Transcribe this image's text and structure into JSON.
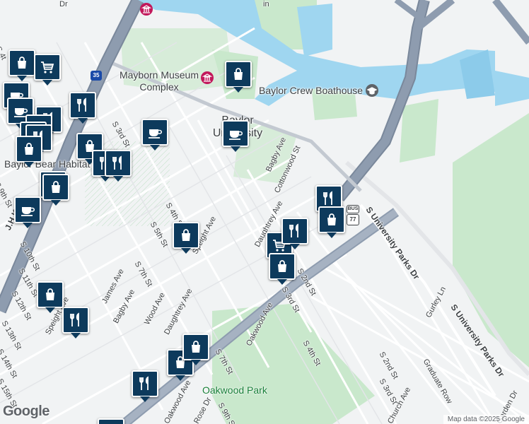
{
  "map": {
    "colors": {
      "background": "#f1f3f4",
      "water": "#9fd6f0",
      "park": "#c9e8cc",
      "highway": "#8e9caf",
      "highway_casing": "#7a889b",
      "road": "#ffffff",
      "minor_road": "#e3e5e8",
      "marker": "#0d3a5c"
    },
    "pois": {
      "museum": "Mayborn Museum Complex",
      "boathouse": "Baylor Crew Boathouse",
      "university": "Baylor University",
      "bear_habitat": "Baylor Bear Habitat",
      "park": "Oakwood Park"
    },
    "streets": {
      "s_4th_top": "S 4th St",
      "s_3rd": "S 3rd St",
      "bagby_top": "Bagby Ave",
      "cottonwood": "Cottonwood St",
      "daughtrey_top": "Daughtrey Ave",
      "s_4th_mid": "S 4th St",
      "speight_mid": "Speight Ave",
      "s_5th": "S 5th St",
      "s_7th": "S 7th St",
      "s_9th": "S 9th St",
      "s_10th": "S 10th St",
      "s_11th": "S 11th St",
      "s_12th": "S 12th St",
      "s_13th": "S 13th St",
      "s_14th": "S 14th St",
      "s_15th": "S 15th St",
      "james": "James Ave",
      "bagby_low": "Bagby Ave",
      "wood": "Wood Ave",
      "daughtrey_low": "Daughtrey Ave",
      "speight_low": "Speight Ave",
      "s_2nd_a": "S 2nd St",
      "s_3rd_b": "S 3rd St",
      "oakwood_mid": "Oakwood Ave",
      "s_4th_low": "S 4th St",
      "s_7th_low": "S 7th St",
      "oakwood_low": "Oakwood Ave",
      "s_9th_low": "S 9th St",
      "rose": "Rose Dr",
      "s_2nd_b": "S 2nd St",
      "s_3rd_c": "S 3rd St",
      "church": "Church Ave",
      "graduate": "Graduate Row",
      "gurley": "Gurley Ln",
      "garden": "Garden Dr",
      "univ_parks_1": "S University Parks Dr",
      "univ_parks_2": "S University Parks Dr",
      "jhk": "J.H.K.",
      "s_4t_top": "S 4t",
      "dr_top": "Dr",
      "in_top": "in"
    },
    "shields": {
      "i35": "35",
      "bus": "BUS",
      "us77": "77"
    },
    "markers": [
      {
        "icon": "shopping-bag"
      },
      {
        "icon": "shopping-cart"
      },
      {
        "icon": "cafe-cup"
      },
      {
        "icon": "restaurant-utensils"
      },
      {
        "icon": "cafe-cup"
      },
      {
        "icon": "restaurant-utensils"
      },
      {
        "icon": "cafe-cup"
      },
      {
        "icon": "cafe-cup"
      },
      {
        "icon": "shopping-bag"
      },
      {
        "icon": "restaurant-utensils"
      },
      {
        "icon": "restaurant-utensils"
      },
      {
        "icon": "shopping-bag"
      },
      {
        "icon": "cafe-cup"
      },
      {
        "icon": "cafe-cup"
      },
      {
        "icon": "shopping-bag"
      },
      {
        "icon": "shopping-bag"
      },
      {
        "icon": "restaurant-utensils"
      },
      {
        "icon": "shopping-bag"
      },
      {
        "icon": "restaurant-utensils"
      },
      {
        "icon": "shopping-cart"
      },
      {
        "icon": "shopping-bag"
      },
      {
        "icon": "shopping-bag"
      },
      {
        "icon": "restaurant-utensils"
      },
      {
        "icon": "shopping-bag"
      },
      {
        "icon": "restaurant-utensils"
      },
      {
        "icon": "shopping-bag"
      },
      {
        "icon": "restaurant-utensils"
      },
      {
        "icon": "shopping-bag"
      }
    ],
    "logo": "Google",
    "attribution": "Map data ©2025 Google"
  }
}
